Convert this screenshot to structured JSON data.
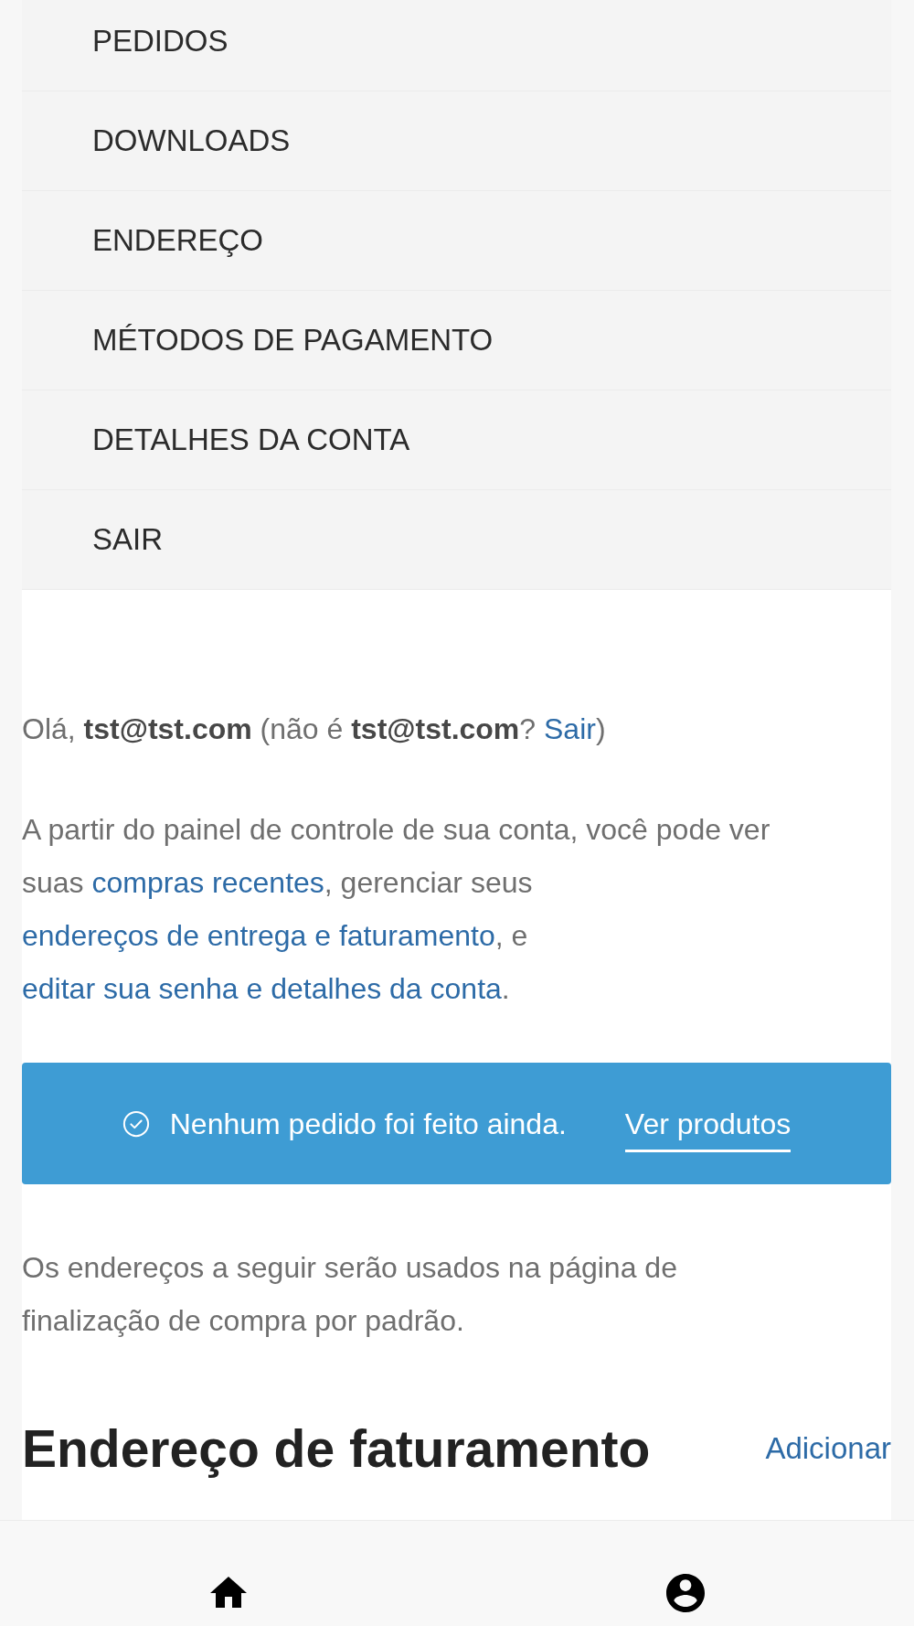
{
  "account_menu": {
    "items": [
      {
        "label": "PEDIDOS"
      },
      {
        "label": "DOWNLOADS"
      },
      {
        "label": "ENDEREÇO"
      },
      {
        "label": "MÉTODOS DE PAGAMENTO"
      },
      {
        "label": "DETALHES DA CONTA"
      },
      {
        "label": "SAIR"
      }
    ]
  },
  "greeting": {
    "parts": [
      {
        "kind": "text",
        "text": "Olá, "
      },
      {
        "kind": "bold",
        "text": "tst@tst.com"
      },
      {
        "kind": "text",
        "text": " (não é "
      },
      {
        "kind": "bold",
        "text": "tst@tst.com"
      },
      {
        "kind": "text",
        "text": "? "
      },
      {
        "kind": "link",
        "text": "Sair"
      },
      {
        "kind": "text",
        "text": ")"
      }
    ]
  },
  "dashboard_intro": {
    "parts": [
      {
        "kind": "text",
        "text": "A partir do painel de controle de sua conta, você pode ver suas "
      },
      {
        "kind": "link",
        "text": "compras recentes"
      },
      {
        "kind": "text",
        "text": ", gerenciar seus "
      },
      {
        "kind": "link",
        "text": "endereços de entrega e faturamento"
      },
      {
        "kind": "text",
        "text": ", e "
      },
      {
        "kind": "link",
        "text": "editar sua senha e detalhes da conta"
      },
      {
        "kind": "text",
        "text": "."
      }
    ]
  },
  "notice": {
    "message": "Nenhum pedido foi feito ainda.",
    "action": "Ver produtos"
  },
  "addresses_intro": "Os endereços a seguir serão usados na página de finalização de compra por padrão.",
  "billing_address": {
    "heading": "Endereço de faturamento",
    "action": "Adicionar"
  }
}
